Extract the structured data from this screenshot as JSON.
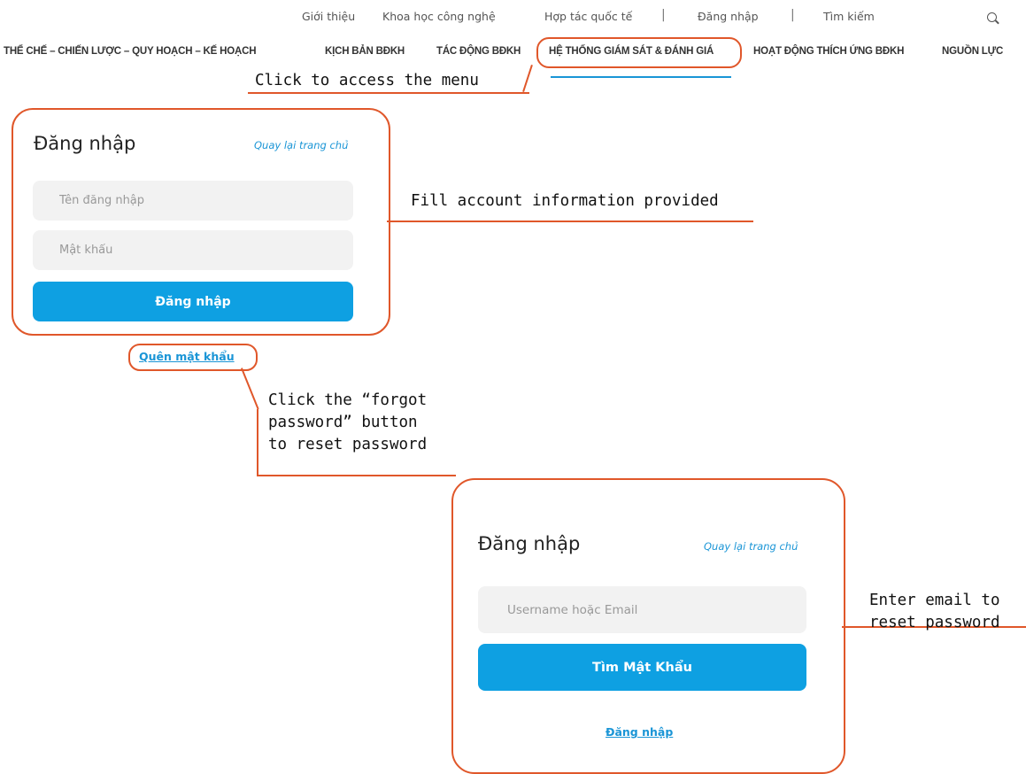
{
  "top_nav": {
    "items": [
      "Giới thiệu",
      "Khoa học công nghệ",
      "Hợp tác quốc tế",
      "Đăng nhập",
      "Tìm kiếm"
    ],
    "separator": "|"
  },
  "main_nav": {
    "items": [
      "THỂ CHẾ – CHIẾN LƯỢC – QUY HOẠCH – KẾ HOẠCH",
      "KỊCH BẢN BĐKH",
      "TÁC ĐỘNG BĐKH",
      "HỆ THỐNG GIÁM SÁT & ĐÁNH GIÁ",
      "HOẠT ĐỘNG THÍCH ỨNG BĐKH",
      "NGUỒN LỰC"
    ],
    "active_index": 3
  },
  "callouts": {
    "menu": "Click to access the menu",
    "fill": "Fill account information provided",
    "forgot": [
      "Click the “forgot",
      "password” button",
      "to reset password"
    ],
    "email": [
      "Enter email to",
      "reset password"
    ]
  },
  "login_card": {
    "title": "Đăng nhập",
    "back_link": "Quay lại trang chủ",
    "username_placeholder": "Tên đăng nhập",
    "password_placeholder": "Mật khẩu",
    "submit_label": "Đăng nhập"
  },
  "forgot_link": "Quên mật khẩu",
  "reset_card": {
    "title": "Đăng nhập",
    "back_link": "Quay lại trang chủ",
    "email_placeholder": "Username hoặc Email",
    "submit_label": "Tìm Mật Khẩu",
    "login_link": "Đăng nhập"
  },
  "colors": {
    "accent": "#0ea0e2",
    "annotation": "#e0572a",
    "link": "#1a95d6"
  }
}
